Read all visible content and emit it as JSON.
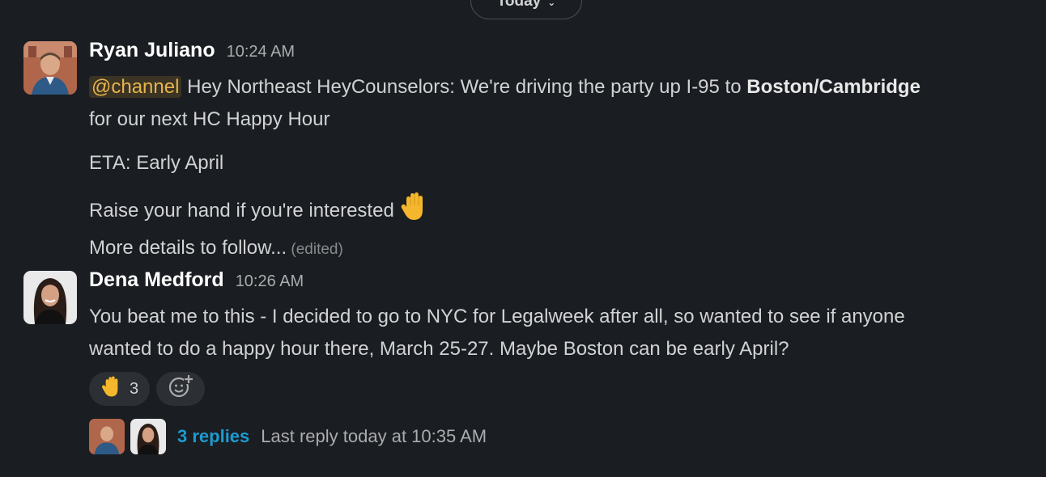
{
  "divider": {
    "label": "Today",
    "chevron": "⌄"
  },
  "messages": [
    {
      "author": "Ryan Juliano",
      "time": "10:24 AM",
      "mention": "@channel",
      "line1_text": " Hey Northeast HeyCounselors: We're driving the party up I-95 to ",
      "line1_bold": "Boston/Cambridge",
      "line2": "for our next HC Happy Hour",
      "line3": "ETA: Early April",
      "line4": "Raise your hand if you're interested ",
      "line5": "More details to follow...",
      "edited": " (edited)"
    },
    {
      "author": "Dena Medford",
      "time": "10:26 AM",
      "line1": "You beat me to this - I decided to go to NYC for Legalweek after all, so wanted to see if anyone",
      "line2": "wanted to do a happy hour there, March 25-27. Maybe Boston can be early April?",
      "reaction_count": "3",
      "thread_replies": "3 replies",
      "thread_last": "Last reply today at 10:35 AM"
    }
  ],
  "icons": {
    "hand": "raised-hand-icon",
    "add_reaction": "add-reaction-icon"
  },
  "colors": {
    "background": "#1a1d21",
    "mention_text": "#e8b44c",
    "link": "#1d9bd1"
  }
}
